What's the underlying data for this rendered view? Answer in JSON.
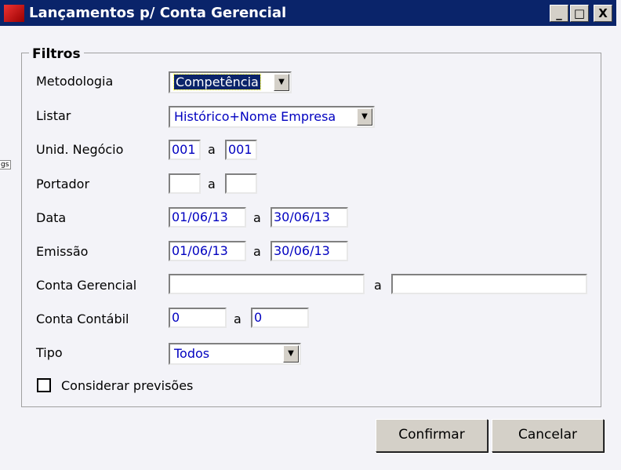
{
  "window": {
    "title": "Lançamentos p/ Conta Gerencial",
    "minimize": "_",
    "maximize": "□",
    "close": "X"
  },
  "tooltip": "gs",
  "group": "Filtros",
  "sep": "a",
  "fields": {
    "metodologia": {
      "label": "Metodologia",
      "value": "Competência"
    },
    "listar": {
      "label": "Listar",
      "value": "Histórico+Nome Empresa"
    },
    "unid": {
      "label": "Unid. Negócio",
      "from": "001",
      "to": "001"
    },
    "portador": {
      "label": "Portador",
      "from": "",
      "to": ""
    },
    "data": {
      "label": "Data",
      "from": "01/06/13",
      "to": "30/06/13"
    },
    "emissao": {
      "label": "Emissão",
      "from": "01/06/13",
      "to": "30/06/13"
    },
    "conta_gerencial": {
      "label": "Conta Gerencial",
      "from": "",
      "to": ""
    },
    "conta_contabil": {
      "label": "Conta Contábil",
      "from": "0",
      "to": "0"
    },
    "tipo": {
      "label": "Tipo",
      "value": "Todos"
    }
  },
  "checkbox": {
    "label": "Considerar previsões",
    "checked": false
  },
  "buttons": {
    "confirm": "Confirmar",
    "cancel": "Cancelar"
  }
}
